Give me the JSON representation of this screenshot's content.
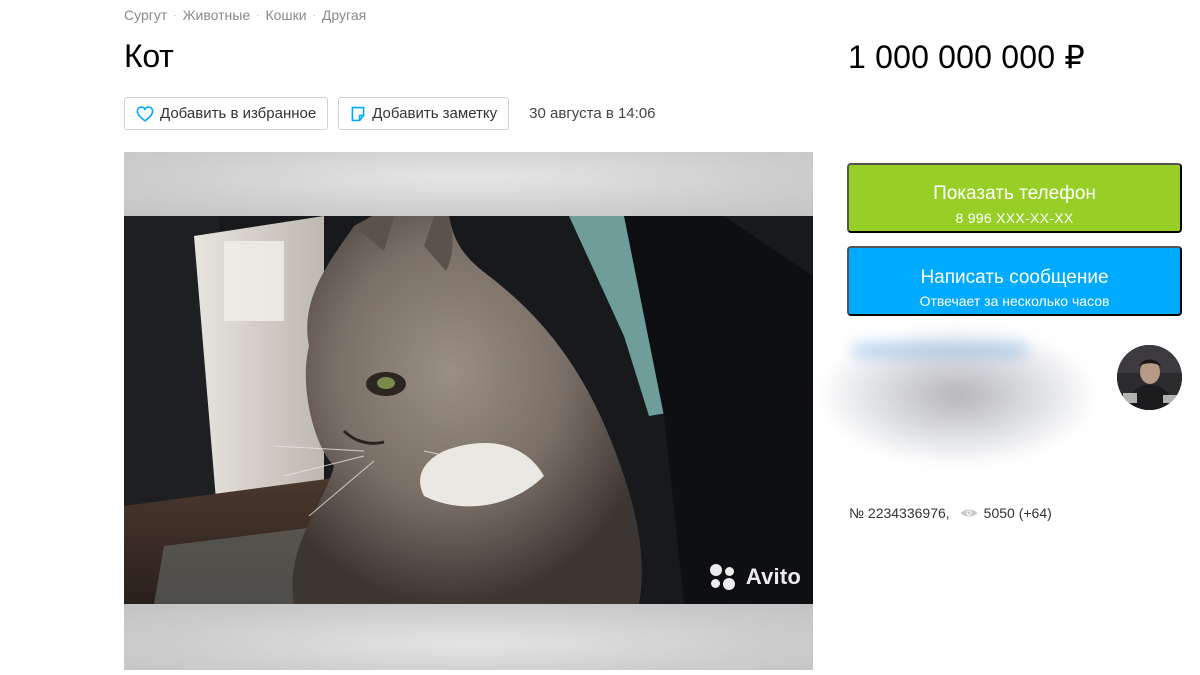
{
  "breadcrumb": [
    "Сургут",
    "Животные",
    "Кошки",
    "Другая"
  ],
  "title": "Кот",
  "price": "1 000 000 000 ₽",
  "actions": {
    "favorite_label": "Добавить в избранное",
    "note_label": "Добавить заметку",
    "date": "30 августа в 14:06"
  },
  "gallery": {
    "watermark": "Avito"
  },
  "phone_button": {
    "label": "Показать телефон",
    "number": "8 996 XXX-XX-XX"
  },
  "message_button": {
    "label": "Написать сообщение",
    "sub": "Отвечает за несколько часов"
  },
  "meta": {
    "ad_number": "№ 2234336976,",
    "views": "5050 (+64)"
  },
  "colors": {
    "phone_green": "#97cf26",
    "message_blue": "#00aaff",
    "favorite_icon": "#00aaff"
  }
}
